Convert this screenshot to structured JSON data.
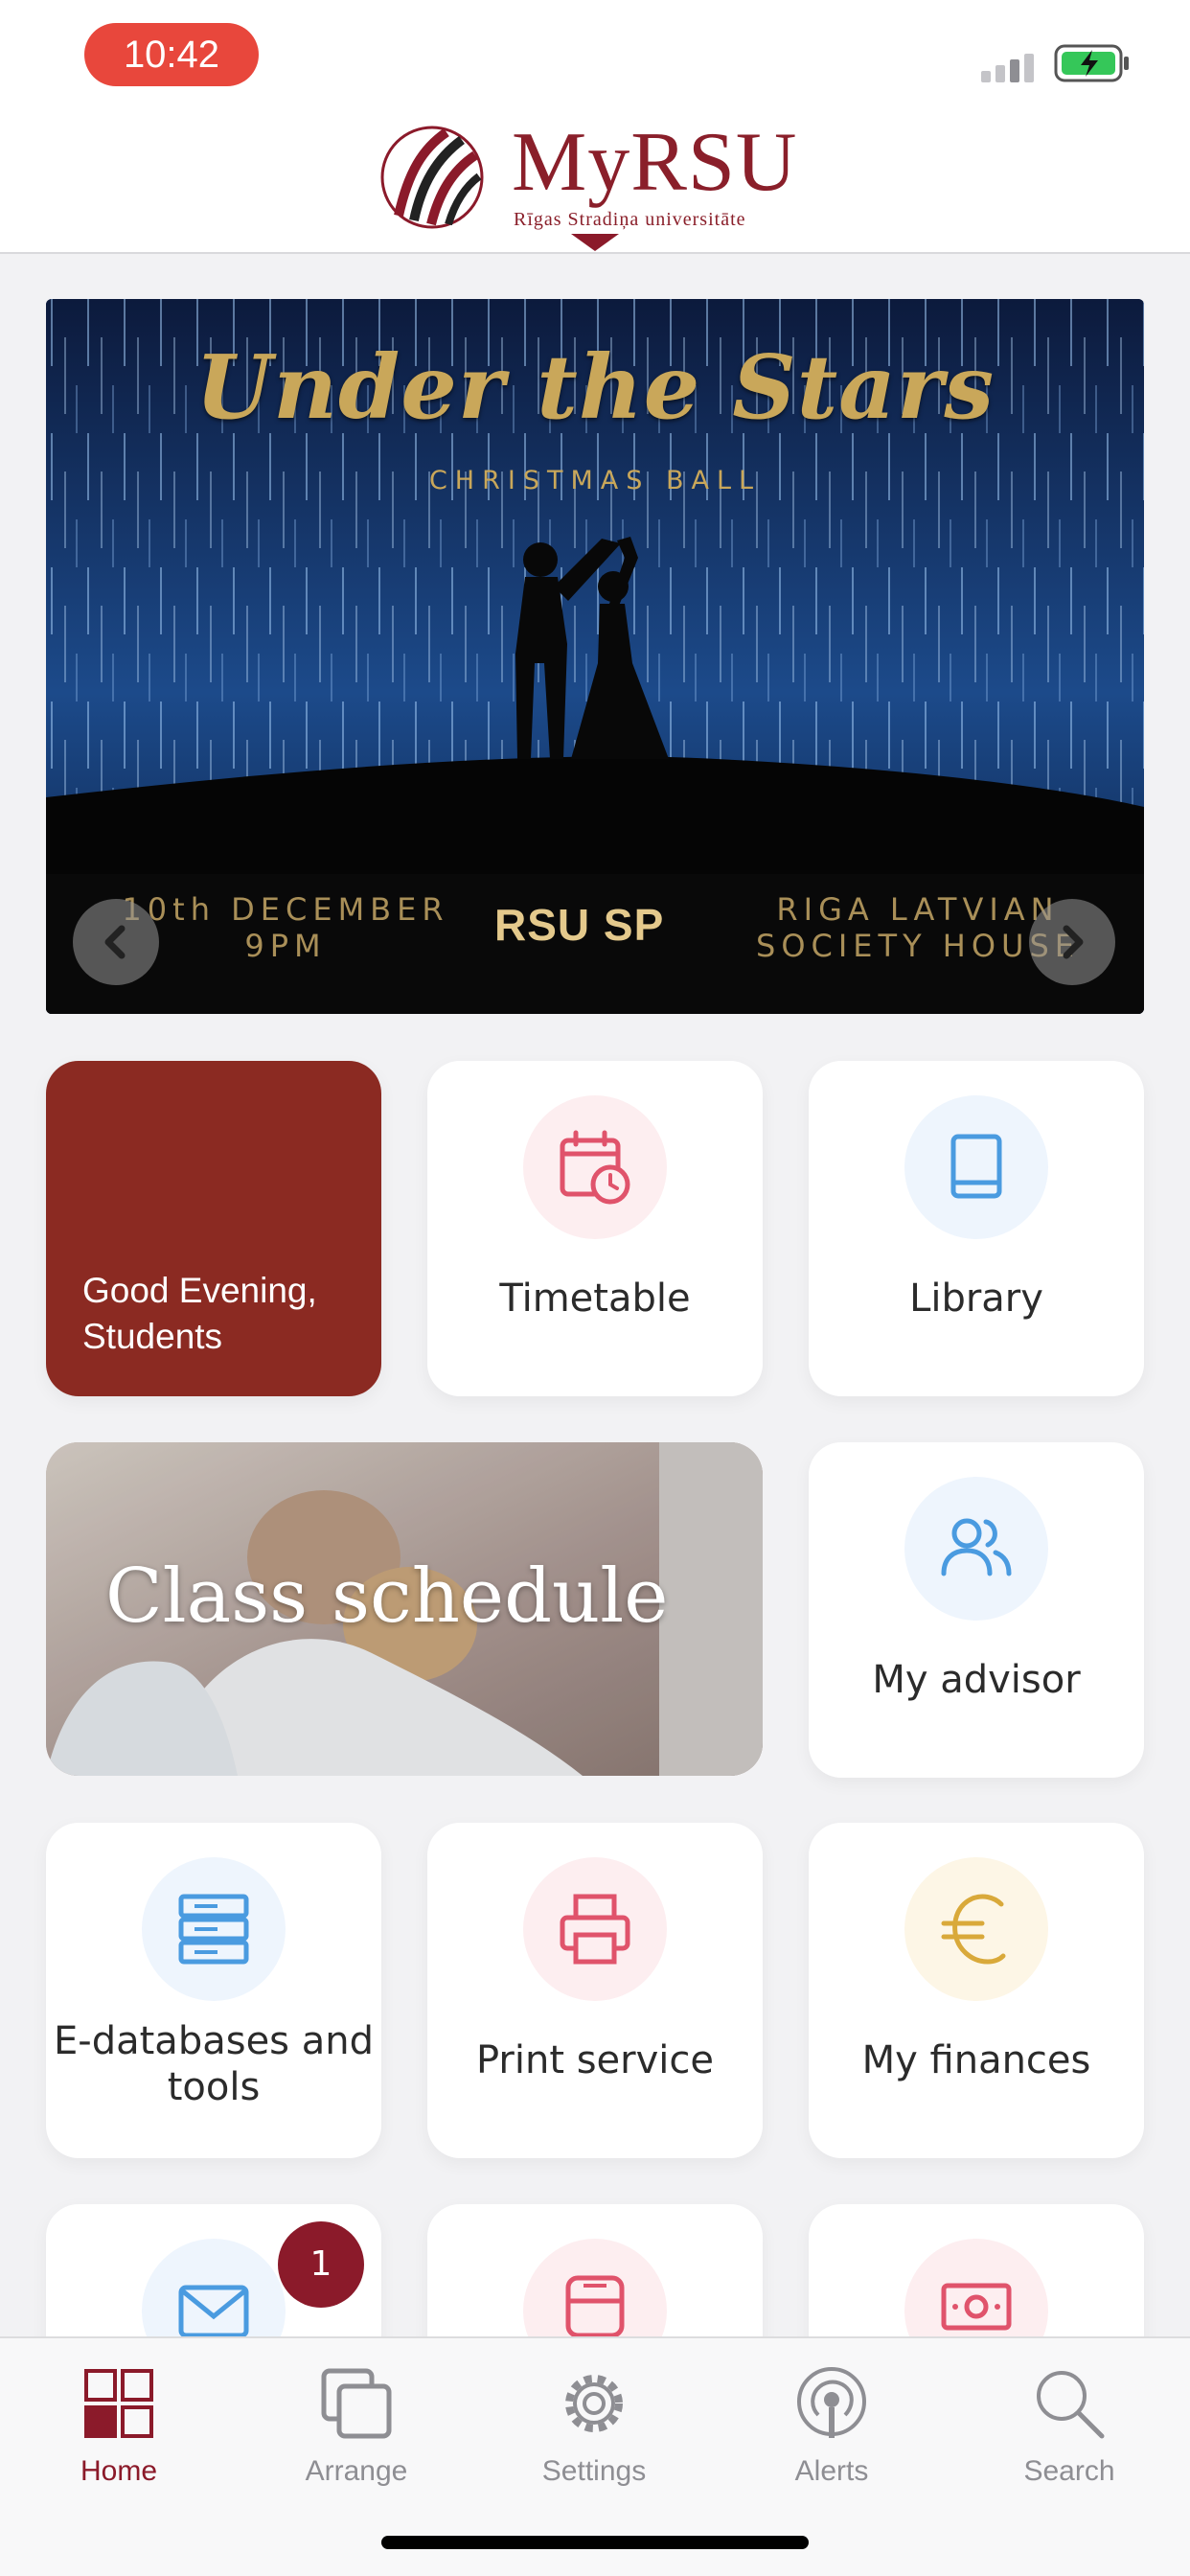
{
  "status_bar": {
    "time": "10:42"
  },
  "header": {
    "logo_text": "MyRSU",
    "logo_subtitle": "Rīgas Stradiņa universitāte"
  },
  "banner": {
    "title": "Under the Stars",
    "subtitle": "CHRISTMAS BALL",
    "date_text": "10th DECEMBER\n9PM",
    "brand": "RSU SP",
    "venue_text": "RIGA LATVIAN\nSOCIETY HOUSE"
  },
  "tiles": {
    "greeting": "Good Evening, Students",
    "timetable": "Timetable",
    "library": "Library",
    "class_schedule": "Class schedule",
    "my_advisor": "My advisor",
    "e_databases": "E-databases and tools",
    "print_service": "Print service",
    "my_finances": "My finances",
    "mail_badge": "1"
  },
  "tabbar": {
    "items": [
      {
        "label": "Home",
        "icon": "grid-icon",
        "active": true
      },
      {
        "label": "Arrange",
        "icon": "copy-icon",
        "active": false
      },
      {
        "label": "Settings",
        "icon": "gear-icon",
        "active": false
      },
      {
        "label": "Alerts",
        "icon": "broadcast-icon",
        "active": false
      },
      {
        "label": "Search",
        "icon": "search-icon",
        "active": false
      }
    ]
  },
  "colors": {
    "brand": "#8b1a2a",
    "greeting_tile": "#8b2a22",
    "time_pill": "#e8473c",
    "icon_pink": "#e0536b",
    "icon_blue": "#4a9be0",
    "icon_gold": "#d9a93a"
  }
}
